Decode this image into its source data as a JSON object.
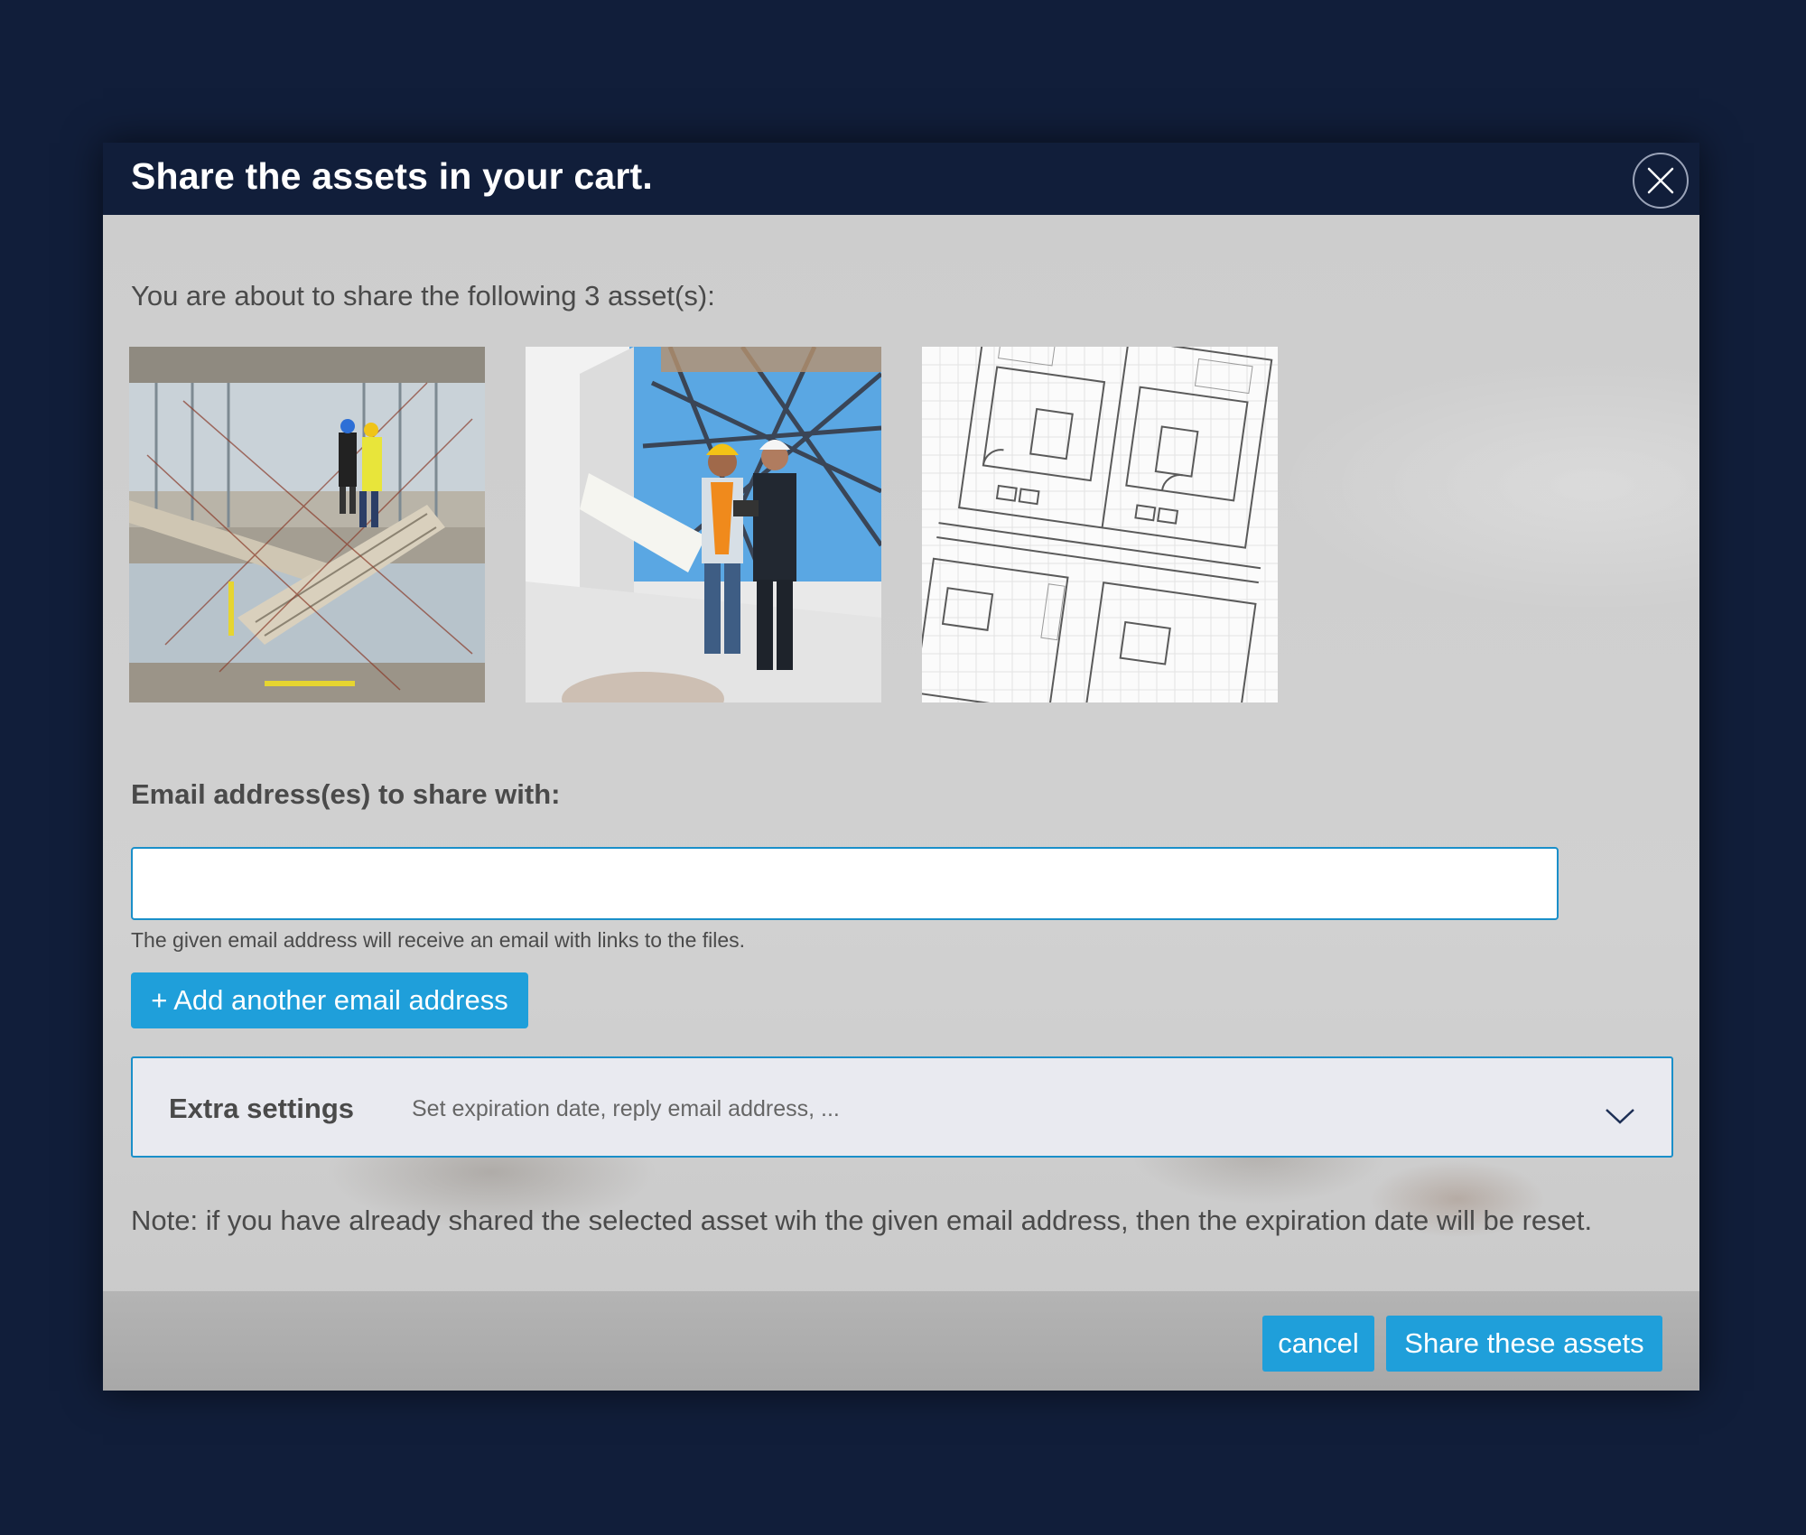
{
  "modal": {
    "title": "Share the assets in your cart.",
    "close_icon": "close-icon"
  },
  "intro": {
    "text": "You are about to share the following 3 asset(s):"
  },
  "assets": [
    {
      "kind": "photo"
    },
    {
      "kind": "photo"
    },
    {
      "kind": "blueprint"
    }
  ],
  "email": {
    "label": "Email address(es) to share with:",
    "value": "",
    "placeholder": "",
    "helper": "The given email address will receive an email with links to the files.",
    "add_label": "+ Add another email address"
  },
  "extra_settings": {
    "title": "Extra settings",
    "description": "Set expiration date, reply email address, ...",
    "icon": "chevron-down-icon"
  },
  "note": {
    "text": "Note: if you have already shared the selected asset wih the given email address, then the expiration date will be reset."
  },
  "footer": {
    "cancel_label": "cancel",
    "share_label": "Share these assets"
  },
  "colors": {
    "page_background": "#111e3a",
    "header_background": "#111e3a",
    "accent": "#1f9fda",
    "input_border": "#1a8fc9"
  }
}
